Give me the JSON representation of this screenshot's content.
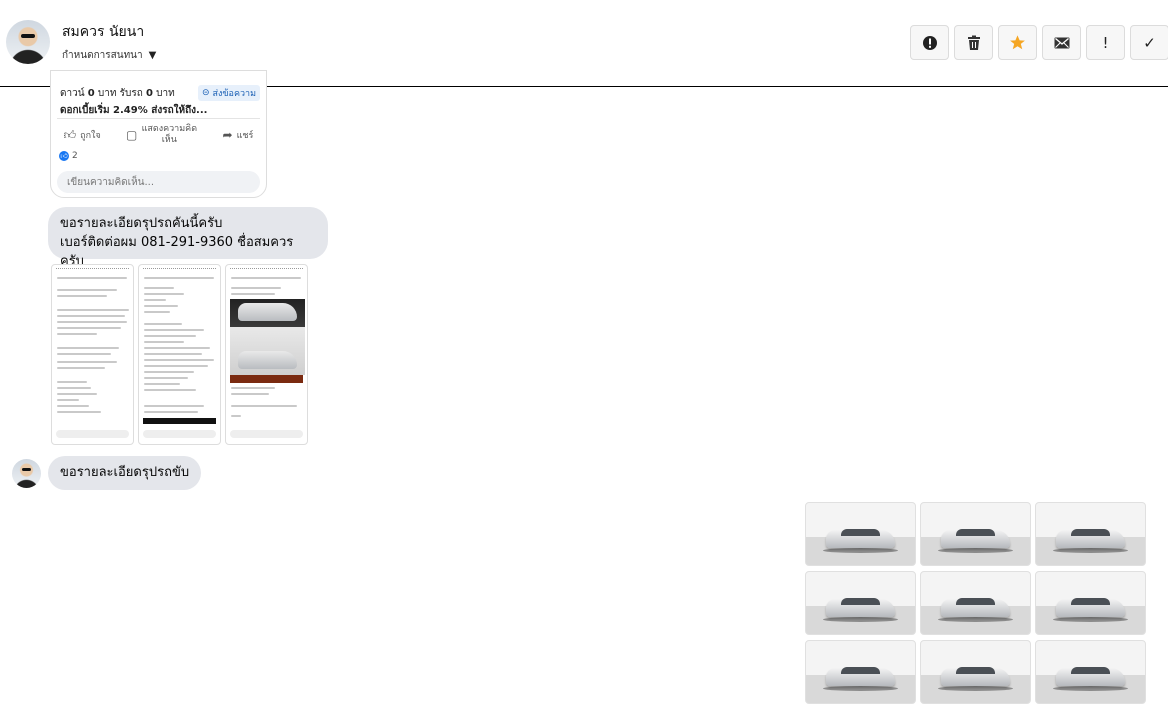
{
  "header": {
    "contact_name": "สมควร นัยนา",
    "chat_settings_label": "กำหนดการสนทนา",
    "actions": [
      {
        "name": "report-icon",
        "glyph": "!"
      },
      {
        "name": "trash-icon",
        "glyph": "🗑"
      },
      {
        "name": "star-icon",
        "glyph": "★"
      },
      {
        "name": "envelope-icon",
        "glyph": "✉"
      },
      {
        "name": "exclamation-icon",
        "glyph": "!"
      },
      {
        "name": "check-icon",
        "glyph": "✓"
      }
    ]
  },
  "shared_post": {
    "line1_prefix": "ดาวน์ ",
    "line1_bold1": "0",
    "line1_mid": " บาท รับรถ ",
    "line1_bold2": "0",
    "line1_suffix": " บาท",
    "line2_prefix": "ดอกเบี้ยเริ่ม ",
    "line2_bold": "2.49%",
    "line2_suffix": " ส่งรถให้ถึง...",
    "send_message_label": "ส่งข้อความ",
    "like_label": "ถูกใจ",
    "comment_label": "แสดงความคิดเห็น",
    "share_label": "แชร์",
    "like_count": "2",
    "comment_placeholder": "เขียนความคิดเห็น..."
  },
  "messages": [
    {
      "line1": "ขอรายละเอียดรุปรถคันนี้ครับ",
      "line2": "เบอร์ติดต่อผม 081-291-9360 ชื่อสมควรครับ"
    },
    {
      "line1": "ขอรายละเอียดรุปรถขับ"
    }
  ],
  "colors": {
    "bubble_bg": "#e4e6eb",
    "star": "#f5a623",
    "link_blue": "#1877f2"
  }
}
